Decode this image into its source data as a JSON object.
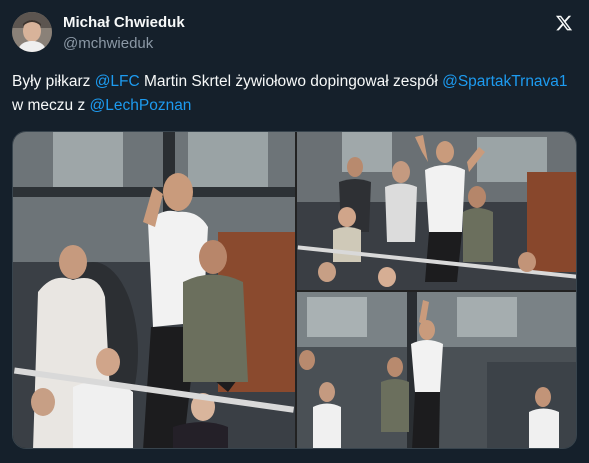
{
  "author": {
    "display_name": "Michał Chwieduk",
    "handle": "@mchwieduk"
  },
  "tweet": {
    "segments": [
      {
        "type": "text",
        "text": "Były piłkarz "
      },
      {
        "type": "mention",
        "text": "@LFC"
      },
      {
        "type": "text",
        "text": " Martin Skrtel żywiołowo dopingował zespół "
      },
      {
        "type": "mention",
        "text": "@SpartakTrnava1"
      },
      {
        "type": "text",
        "text": " w meczu z "
      },
      {
        "type": "mention",
        "text": "@LechPoznan"
      }
    ]
  },
  "media": {
    "photos": [
      {
        "name": "photo-main"
      },
      {
        "name": "photo-top-right"
      },
      {
        "name": "photo-bottom-right"
      }
    ]
  },
  "icons": {
    "brand": "x-logo-icon"
  },
  "colors": {
    "background": "#15202b",
    "text": "#f7f9f9",
    "secondary": "#8b98a5",
    "link": "#1d9bf0",
    "border": "#38444d"
  }
}
